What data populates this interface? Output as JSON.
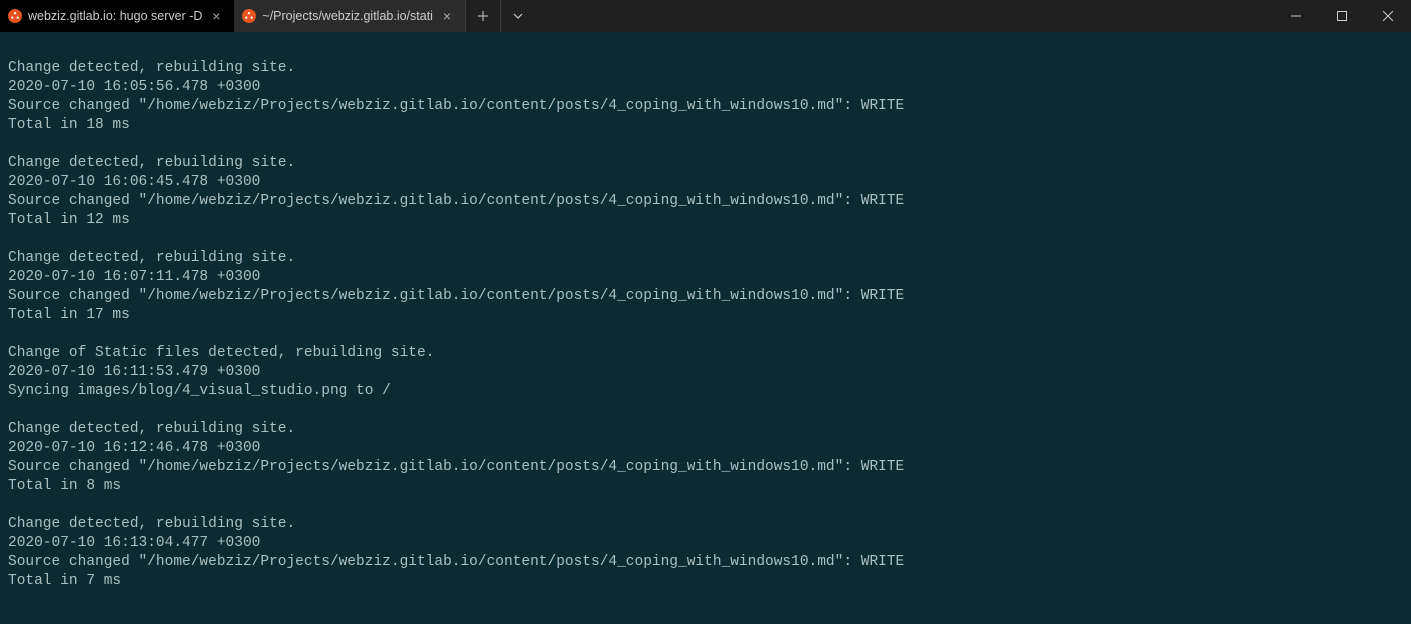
{
  "tabs": [
    {
      "label": "webziz.gitlab.io: hugo server -D",
      "active": true
    },
    {
      "label": "~/Projects/webziz.gitlab.io/stati",
      "active": false
    }
  ],
  "terminal_lines": [
    "",
    "Change detected, rebuilding site.",
    "2020-07-10 16:05:56.478 +0300",
    "Source changed \"/home/webziz/Projects/webziz.gitlab.io/content/posts/4_coping_with_windows10.md\": WRITE",
    "Total in 18 ms",
    "",
    "Change detected, rebuilding site.",
    "2020-07-10 16:06:45.478 +0300",
    "Source changed \"/home/webziz/Projects/webziz.gitlab.io/content/posts/4_coping_with_windows10.md\": WRITE",
    "Total in 12 ms",
    "",
    "Change detected, rebuilding site.",
    "2020-07-10 16:07:11.478 +0300",
    "Source changed \"/home/webziz/Projects/webziz.gitlab.io/content/posts/4_coping_with_windows10.md\": WRITE",
    "Total in 17 ms",
    "",
    "Change of Static files detected, rebuilding site.",
    "2020-07-10 16:11:53.479 +0300",
    "Syncing images/blog/4_visual_studio.png to /",
    "",
    "Change detected, rebuilding site.",
    "2020-07-10 16:12:46.478 +0300",
    "Source changed \"/home/webziz/Projects/webziz.gitlab.io/content/posts/4_coping_with_windows10.md\": WRITE",
    "Total in 8 ms",
    "",
    "Change detected, rebuilding site.",
    "2020-07-10 16:13:04.477 +0300",
    "Source changed \"/home/webziz/Projects/webziz.gitlab.io/content/posts/4_coping_with_windows10.md\": WRITE",
    "Total in 7 ms"
  ]
}
